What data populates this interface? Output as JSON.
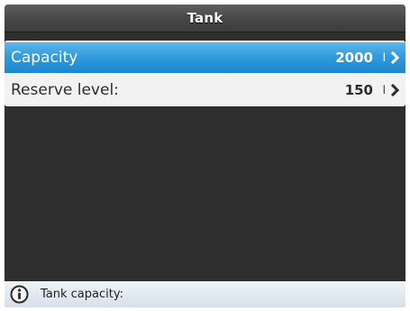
{
  "header": {
    "title": "Tank"
  },
  "settings": {
    "items": [
      {
        "label": "Capacity",
        "value": "2000",
        "unit": "l",
        "selected": true
      },
      {
        "label": "Reserve level:",
        "value": "150",
        "unit": "l",
        "selected": false
      }
    ]
  },
  "status": {
    "text": "Tank capacity:",
    "icon": "info-icon"
  },
  "colors": {
    "accent": "#2f9ade",
    "background": "#2e2e2e",
    "titlebar": "#474747",
    "statusbar": "#dfe7ef"
  }
}
